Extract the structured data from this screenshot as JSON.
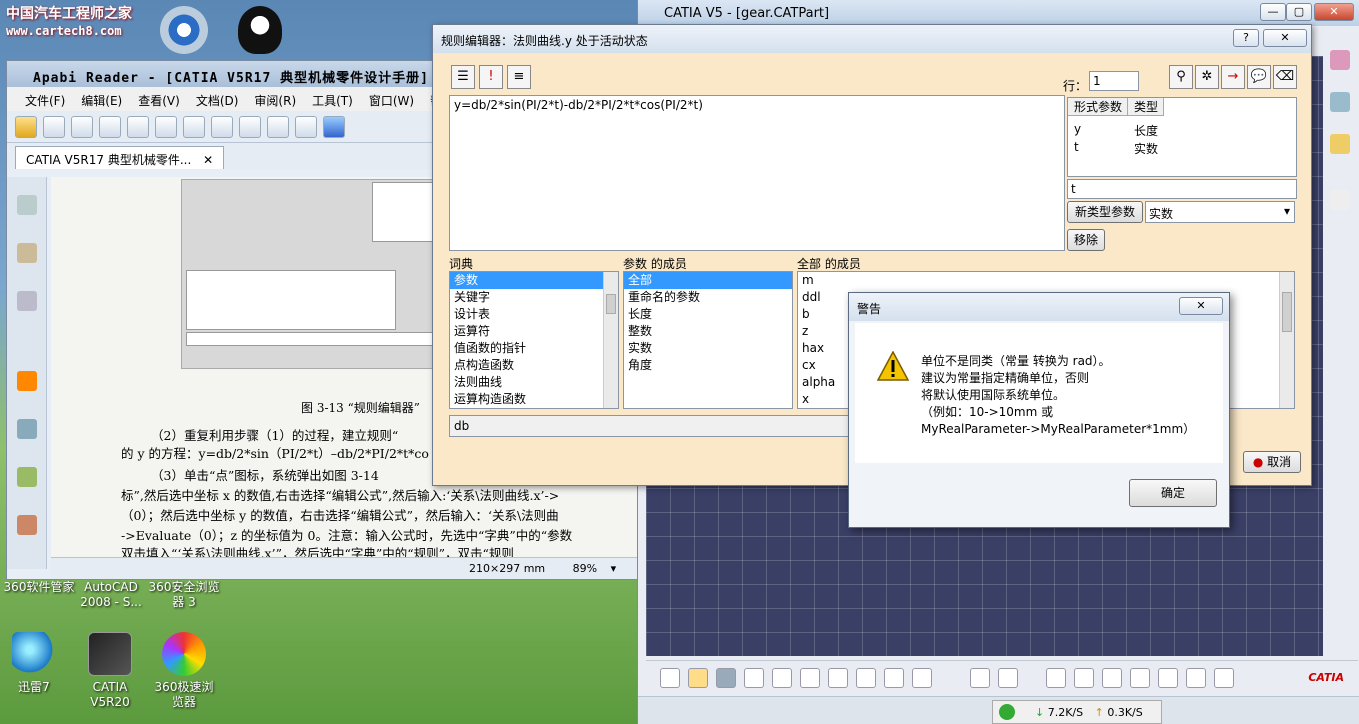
{
  "desktop": {
    "watermark_line1": "中国汽车工程师之家",
    "watermark_line2": "www.cartech8.com",
    "icons_top_labels": [
      "360软件管家",
      "AutoCAD 2008 - S...",
      "360安全浏览器 3"
    ],
    "icons_bottom": [
      {
        "label": "迅雷7",
        "icon": "thunder-bird-icon"
      },
      {
        "label": "CATIA V5R20",
        "icon": "catia-icon"
      },
      {
        "label": "360极速浏览器",
        "icon": "browser-icon"
      }
    ]
  },
  "apabi": {
    "title": "Apabi Reader - [CATIA V5R17 典型机械零件设计手册]",
    "menu": [
      "文件(F)",
      "编辑(E)",
      "查看(V)",
      "文档(D)",
      "审阅(R)",
      "工具(T)",
      "窗口(W)",
      "帮助"
    ],
    "tab_title": "CATIA V5R17 典型机械零件...",
    "figure_caption": "图 3-13 “规则编辑器”",
    "paragraphs": [
      "（2）重复利用步骤（1）的过程，建立规则“",
      "的 y 的方程：y=db/2*sin（PI/2*t）–db/2*PI/2*t*co",
      "（3）单击“点”图标，系统弹出如图 3-14",
      "标”,然后选中坐标 x 的数值,右击选择“编辑公式”,然后输入:‘关系\\法则曲线.x’->",
      "（0）；然后选中坐标 y 的数值，右击选择“编辑公式”，然后输入：‘关系\\法则曲",
      "->Evaluate（0）；z 的坐标值为 0。注意：输入公式时，先选中“字典”中的“参数",
      "双击填入“‘关系\\法则曲线.x’”，然后选中“字典”中的“规则”，双击“规则"
    ],
    "page_size": "210×297 mm",
    "zoom": "89%"
  },
  "catia": {
    "title": "CATIA V5 - [gear.CATPart]",
    "logo_text": "CATIA"
  },
  "rule_editor": {
    "title": "规则编辑器：法则曲线.y 处于活动状态",
    "line_label": "行：",
    "line_value": "1",
    "formula": "y=db/2*sin(PI/2*t)-db/2*PI/2*t*cos(PI/2*t)",
    "formal_params_header": "形式参数",
    "type_header": "类型",
    "params": [
      {
        "name": "y",
        "type": "长度"
      },
      {
        "name": "t",
        "type": "实数"
      }
    ],
    "param_name_value": "t",
    "new_param_button": "新类型参数",
    "new_param_type": "实数",
    "remove_button": "移除",
    "dict_label": "词典",
    "dict_items": [
      "参数",
      "关键字",
      "设计表",
      "运算符",
      "值函数的指针",
      "点构造函数",
      "法则曲线",
      "运算构造函数"
    ],
    "members_label": "参数 的成员",
    "members_items": [
      "全部",
      "重命名的参数",
      "长度",
      "整数",
      "实数",
      "角度"
    ],
    "all_members_label": "全部 的成员",
    "all_members_items": [
      "m",
      "ddl",
      "b",
      "z",
      "hax",
      "cx",
      "alpha",
      "x"
    ],
    "bottom_input": "db",
    "cancel_button": "取消"
  },
  "warning": {
    "title": "警告",
    "lines": [
      "单位不是同类（常量 转换为 rad）。",
      "建议为常量指定精确单位，否则",
      "将默认使用国际系统单位。",
      "（例如：10->10mm 或",
      "MyRealParameter->MyRealParameter*1mm）"
    ],
    "ok_button": "确定"
  },
  "tray": {
    "down_speed": "7.2K/S",
    "up_speed": "0.3K/S"
  },
  "colors": {
    "dialog_bg": "#fae8c8",
    "selection": "#3399ff",
    "catia_canvas": "#3a3f66"
  }
}
